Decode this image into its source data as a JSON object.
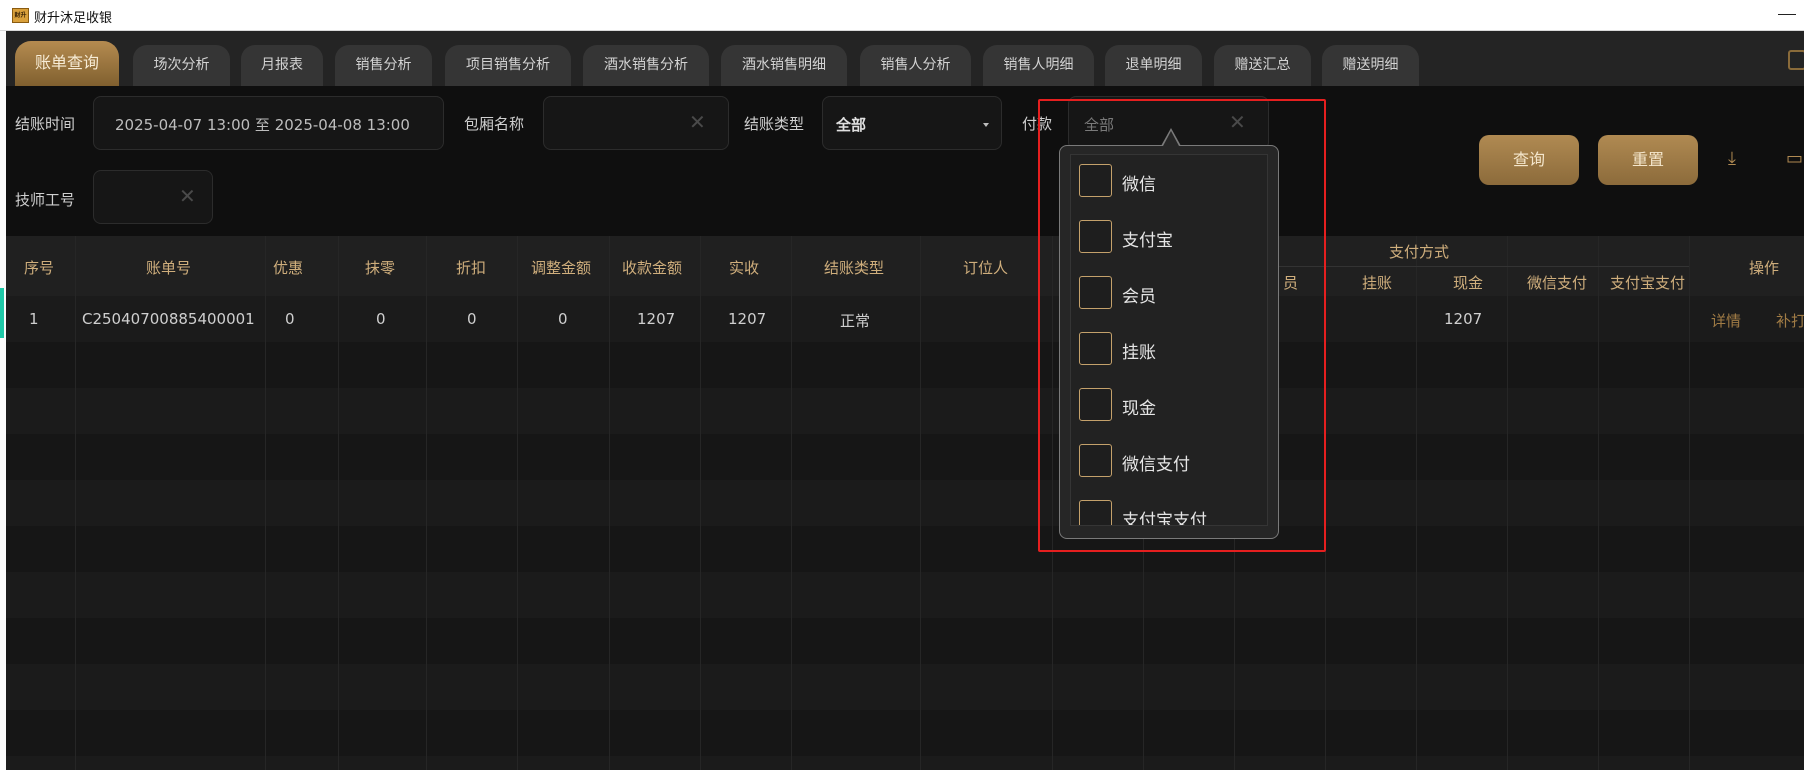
{
  "window": {
    "title": "财升沐足收银",
    "icon_text": "财升"
  },
  "tabs": [
    {
      "label": "账单查询"
    },
    {
      "label": "场次分析"
    },
    {
      "label": "月报表"
    },
    {
      "label": "销售分析"
    },
    {
      "label": "项目销售分析"
    },
    {
      "label": "酒水销售分析"
    },
    {
      "label": "酒水销售明细"
    },
    {
      "label": "销售人分析"
    },
    {
      "label": "销售人明细"
    },
    {
      "label": "退单明细"
    },
    {
      "label": "赠送汇总"
    },
    {
      "label": "赠送明细"
    }
  ],
  "filters": {
    "checkout_time_label": "结账时间",
    "checkout_time_value": "2025-04-07 13:00 至 2025-04-08 13:00",
    "room_label": "包厢名称",
    "checkout_type_label": "结账类型",
    "checkout_type_value": "全部",
    "payment_label": "付款",
    "payment_value": "全部",
    "tech_label": "技师工号",
    "query_button": "查询",
    "reset_button": "重置"
  },
  "table": {
    "headers": {
      "seq": "序号",
      "bill_no": "账单号",
      "discount_offer": "优惠",
      "round_off": "抹零",
      "discount": "折扣",
      "adjust": "调整金额",
      "receivable": "收款金额",
      "actual": "实收",
      "checkout_type": "结账类型",
      "booker": "订位人",
      "payment_group": "支付方式",
      "member_partial": "员",
      "credit": "挂账",
      "cash": "现金",
      "wechat_pay": "微信支付",
      "alipay_pay": "支付宝支付",
      "actions": "操作"
    },
    "rows": [
      {
        "seq": "1",
        "bill_no": "C25040700885400001",
        "discount_offer": "0",
        "round_off": "0",
        "discount": "0",
        "adjust": "0",
        "receivable": "1207",
        "actual": "1207",
        "checkout_type": "正常",
        "cash": "1207",
        "detail": "详情",
        "reprint": "补打"
      }
    ]
  },
  "payment_dropdown": {
    "options": [
      {
        "label": "微信",
        "checked": false
      },
      {
        "label": "支付宝",
        "checked": false
      },
      {
        "label": "会员",
        "checked": false
      },
      {
        "label": "挂账",
        "checked": false
      },
      {
        "label": "现金",
        "checked": false
      },
      {
        "label": "微信支付",
        "checked": false
      },
      {
        "label": "支付宝支付",
        "checked": false
      }
    ]
  },
  "colors": {
    "accent_gold": "#b08a52",
    "highlight_red": "#e51f1f",
    "header_text": "#cfae7c"
  }
}
